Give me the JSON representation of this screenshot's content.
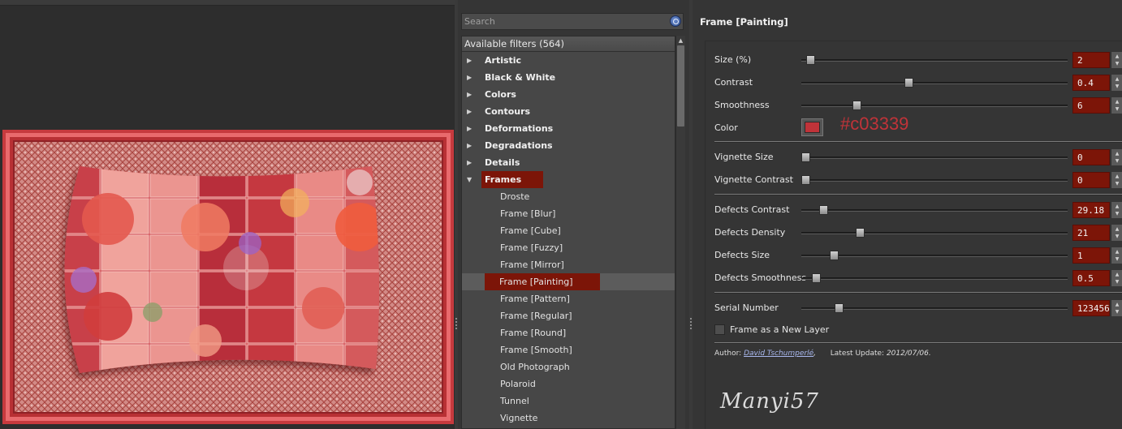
{
  "search": {
    "placeholder": "Search"
  },
  "filters": {
    "header": "Available filters (564)",
    "categories": [
      {
        "label": "Artistic",
        "expanded": false
      },
      {
        "label": "Black & White",
        "expanded": false
      },
      {
        "label": "Colors",
        "expanded": false
      },
      {
        "label": "Contours",
        "expanded": false
      },
      {
        "label": "Deformations",
        "expanded": false
      },
      {
        "label": "Degradations",
        "expanded": false
      },
      {
        "label": "Details",
        "expanded": false
      },
      {
        "label": "Frames",
        "expanded": true
      }
    ],
    "frames_children": [
      "Droste",
      "Frame [Blur]",
      "Frame [Cube]",
      "Frame [Fuzzy]",
      "Frame [Mirror]",
      "Frame [Painting]",
      "Frame [Pattern]",
      "Frame [Regular]",
      "Frame [Round]",
      "Frame [Smooth]",
      "Old Photograph",
      "Polaroid",
      "Tunnel",
      "Vignette"
    ],
    "selected": "Frame [Painting]"
  },
  "params": {
    "title": "Frame [Painting]",
    "size": {
      "label": "Size (%)",
      "value": "2",
      "fraction": 0.02
    },
    "contrast": {
      "label": "Contrast",
      "value": "0.4",
      "fraction": 0.4
    },
    "smoothness": {
      "label": "Smoothness",
      "value": "6",
      "fraction": 0.2
    },
    "color": {
      "label": "Color",
      "hex": "#c03339"
    },
    "vignette_size": {
      "label": "Vignette Size",
      "value": "0",
      "fraction": 0.0
    },
    "vignette_contrast": {
      "label": "Vignette Contrast",
      "value": "0",
      "fraction": 0.0
    },
    "defects_contrast": {
      "label": "Defects Contrast",
      "value": "29.18",
      "fraction": 0.07
    },
    "defects_density": {
      "label": "Defects Density",
      "value": "21",
      "fraction": 0.21
    },
    "defects_size": {
      "label": "Defects Size",
      "value": "1",
      "fraction": 0.11
    },
    "defects_smoothness": {
      "label": "Defects Smoothness",
      "value": "0.5",
      "fraction": 0.04
    },
    "serial_number": {
      "label": "Serial Number",
      "value": "123456",
      "fraction": 0.13
    },
    "new_layer": {
      "label": "Frame as a New Layer",
      "checked": false
    }
  },
  "author": {
    "label": "Author:",
    "name": "David Tschumperlé",
    "update_label": "Latest Update:",
    "update_date": "2012/07/06"
  },
  "signature": "Manyi57",
  "colors": {
    "accent": "#7c1508",
    "frame_red": "#c03339"
  }
}
